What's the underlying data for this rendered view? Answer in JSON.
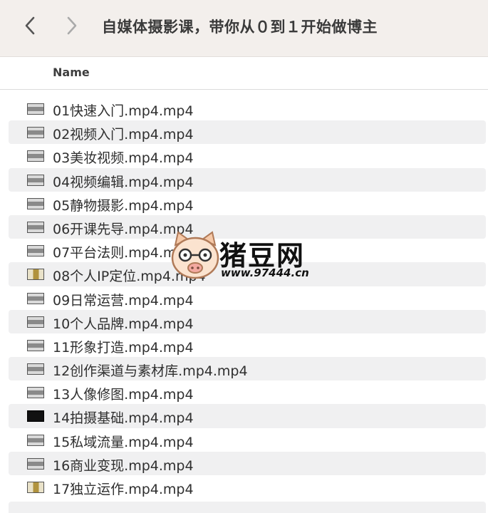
{
  "toolbar": {
    "title": "自媒体摄影课，带你从０到１开始做博主",
    "back_icon": "chevron-left-icon",
    "forward_icon": "chevron-right-icon"
  },
  "column_header": {
    "name": "Name"
  },
  "files": [
    {
      "name": "01快速入门.mp4.mp4"
    },
    {
      "name": "02视频入门.mp4.mp4"
    },
    {
      "name": "03美妆视频.mp4.mp4"
    },
    {
      "name": "04视频编辑.mp4.mp4"
    },
    {
      "name": "05静物摄影.mp4.mp4"
    },
    {
      "name": "06开课先导.mp4.mp4"
    },
    {
      "name": "07平台法则.mp4.mp4"
    },
    {
      "name": "08个人IP定位.mp4.mp4"
    },
    {
      "name": "09日常运营.mp4.mp4"
    },
    {
      "name": "10个人品牌.mp4.mp4"
    },
    {
      "name": "11形象打造.mp4.mp4"
    },
    {
      "name": "12创作渠道与素材库.mp4.mp4"
    },
    {
      "name": "13人像修图.mp4.mp4"
    },
    {
      "name": "14拍摄基础.mp4.mp4"
    },
    {
      "name": "15私域流量.mp4.mp4"
    },
    {
      "name": "16商业变现.mp4.mp4"
    },
    {
      "name": "17独立运作.mp4.mp4"
    }
  ],
  "watermark": {
    "brand": "猪豆网",
    "url": "www.97444.cn"
  }
}
